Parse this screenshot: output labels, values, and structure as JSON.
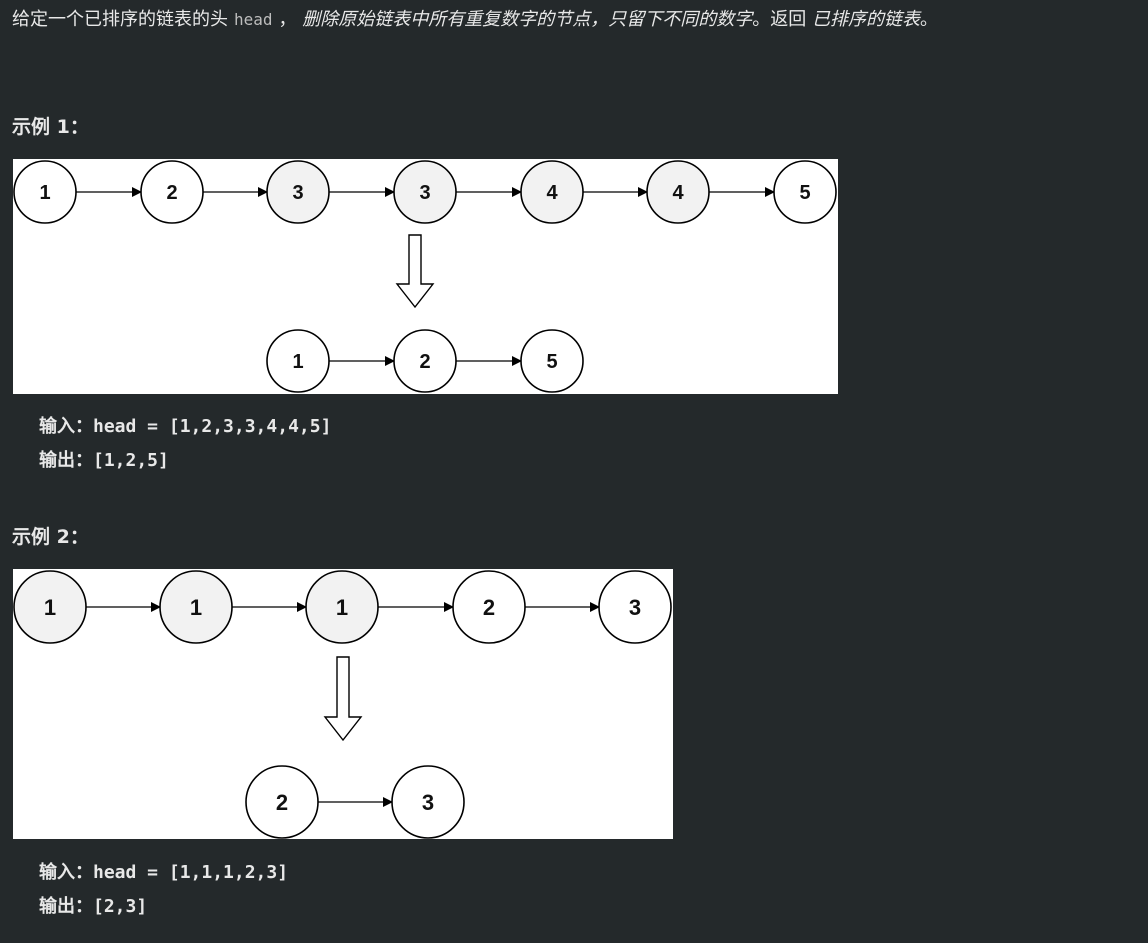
{
  "description": {
    "prefix": "给定一个已排序的链表的头",
    "code": "head",
    "comma": "，",
    "emphasis_1": "删除原始链表中所有重复数字的节点，只留下不同的数字",
    "middle": "。返回",
    "emphasis_2": "已排序的链表",
    "suffix": "。"
  },
  "examples": [
    {
      "title": "示例 1：",
      "input_label": "输入：",
      "input_value": "head = [1,2,3,3,4,4,5]",
      "output_label": "输出：",
      "output_value": "[1,2,5]",
      "diagram": {
        "input_nodes": [
          "1",
          "2",
          "3",
          "3",
          "4",
          "4",
          "5"
        ],
        "input_highlighted": [
          false,
          false,
          true,
          true,
          true,
          true,
          false
        ],
        "output_nodes": [
          "1",
          "2",
          "5"
        ]
      }
    },
    {
      "title": "示例 2：",
      "input_label": "输入：",
      "input_value": "head = [1,1,1,2,3]",
      "output_label": "输出：",
      "output_value": "[2,3]",
      "diagram": {
        "input_nodes": [
          "1",
          "1",
          "1",
          "2",
          "3"
        ],
        "input_highlighted": [
          true,
          true,
          true,
          false,
          false
        ],
        "output_nodes": [
          "2",
          "3"
        ]
      }
    }
  ],
  "colors": {
    "background": "#24292b",
    "text": "#e8e8e8",
    "node_fill": "#ffffff",
    "node_highlight_fill": "#f2f2f2",
    "node_stroke": "#000000"
  }
}
